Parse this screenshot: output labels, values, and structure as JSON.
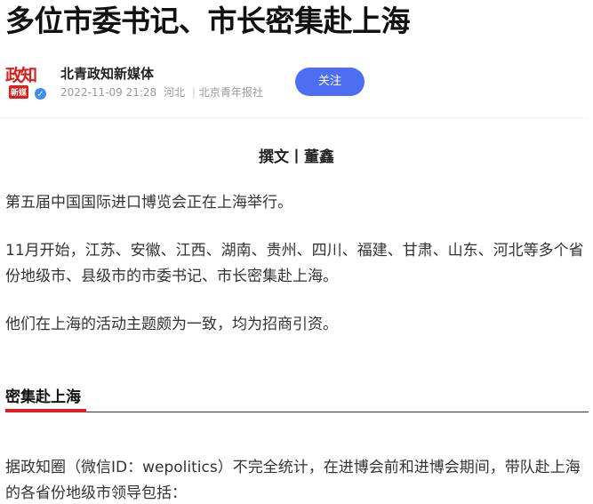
{
  "article": {
    "title": "多位市委书记、市长密集赴上海"
  },
  "author": {
    "name": "北青政知新媒体",
    "avatar_text_main": "政知",
    "avatar_text_sub": "新媒",
    "verified_mark": "✓",
    "date": "2022-11-09 21:28",
    "location": "河北",
    "source": "北京青年报社",
    "follow_label": "关注"
  },
  "content": {
    "byline": "撰文丨董鑫",
    "paragraph1": "第五届中国国际进口博览会正在上海举行。",
    "paragraph2": "11月开始，江苏、安徽、江西、湖南、贵州、四川、福建、甘肃、山东、河北等多个省份地级市、县级市的市委书记、市长密集赴上海。",
    "paragraph3": "他们在上海的活动主题颇为一致，均为招商引资。",
    "section_title": "密集赴上海",
    "paragraph4": "据政知圈（微信ID：wepolitics）不完全统计，在进博会前和进博会期间，带队赴上海的各省份地级市领导包括："
  },
  "colors": {
    "follow_button": "#4e6ef2",
    "section_accent": "#e02020",
    "logo_red": "#d91e1e",
    "verified_blue": "#3b8ef0"
  }
}
